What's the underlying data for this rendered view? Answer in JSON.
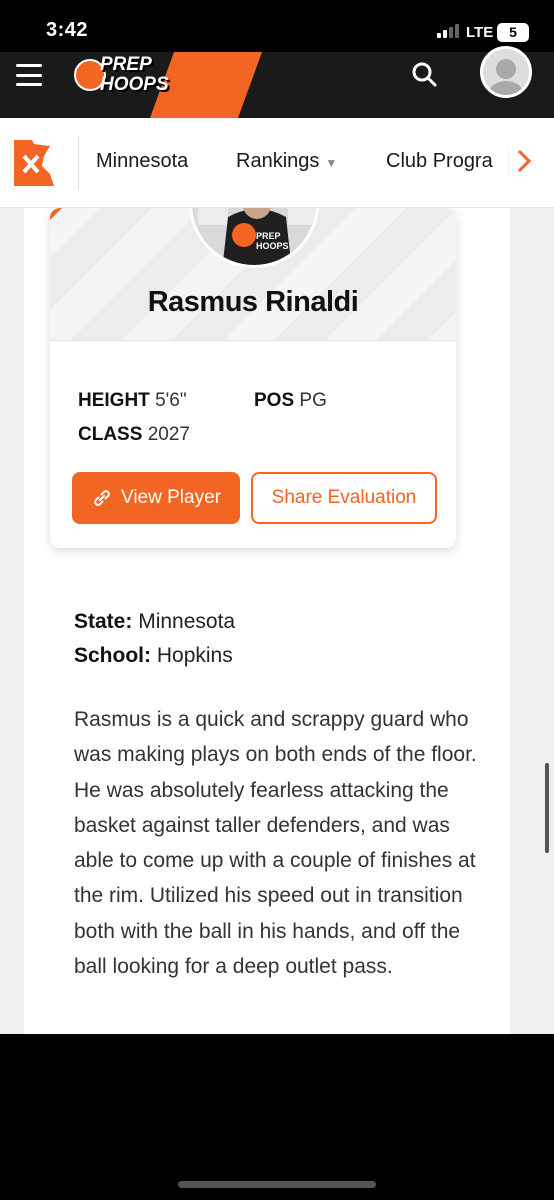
{
  "status_bar": {
    "time": "3:42",
    "network": "LTE",
    "battery": "5"
  },
  "header": {
    "logo_line1": "PREP",
    "logo_line2": "HOOPS",
    "menu_icon": "hamburger-icon",
    "search_icon": "search-icon",
    "avatar_icon": "user-avatar-icon"
  },
  "nav": {
    "state_icon": "minnesota-state-icon",
    "items": [
      {
        "label": "Minnesota"
      },
      {
        "label": "Rankings"
      },
      {
        "label": "Club Progra"
      }
    ],
    "next_icon": "chevron-right-icon"
  },
  "player": {
    "name": "Rasmus Rinaldi",
    "height_label": "HEIGHT",
    "height_value": "5'6\"",
    "pos_label": "POS",
    "pos_value": "PG",
    "class_label": "CLASS",
    "class_value": "2027",
    "view_button": "View Player",
    "share_button": "Share Evaluation",
    "photo_text_1": "PREP",
    "photo_text_2": "HOOPS"
  },
  "details": {
    "state_label": "State:",
    "state_value": "Minnesota",
    "school_label": "School:",
    "school_value": "Hopkins",
    "evaluation": "Rasmus is a quick and scrappy guard who was making plays on both ends of the floor. He was absolutely fearless attacking the basket against taller defenders, and was able to come up with a couple of finishes at the rim. Utilized his speed out in transition both with the ball in his hands, and off the ball looking for a deep outlet pass."
  },
  "colors": {
    "brand_orange": "#f26522",
    "header_dark": "#1a1a1a"
  }
}
